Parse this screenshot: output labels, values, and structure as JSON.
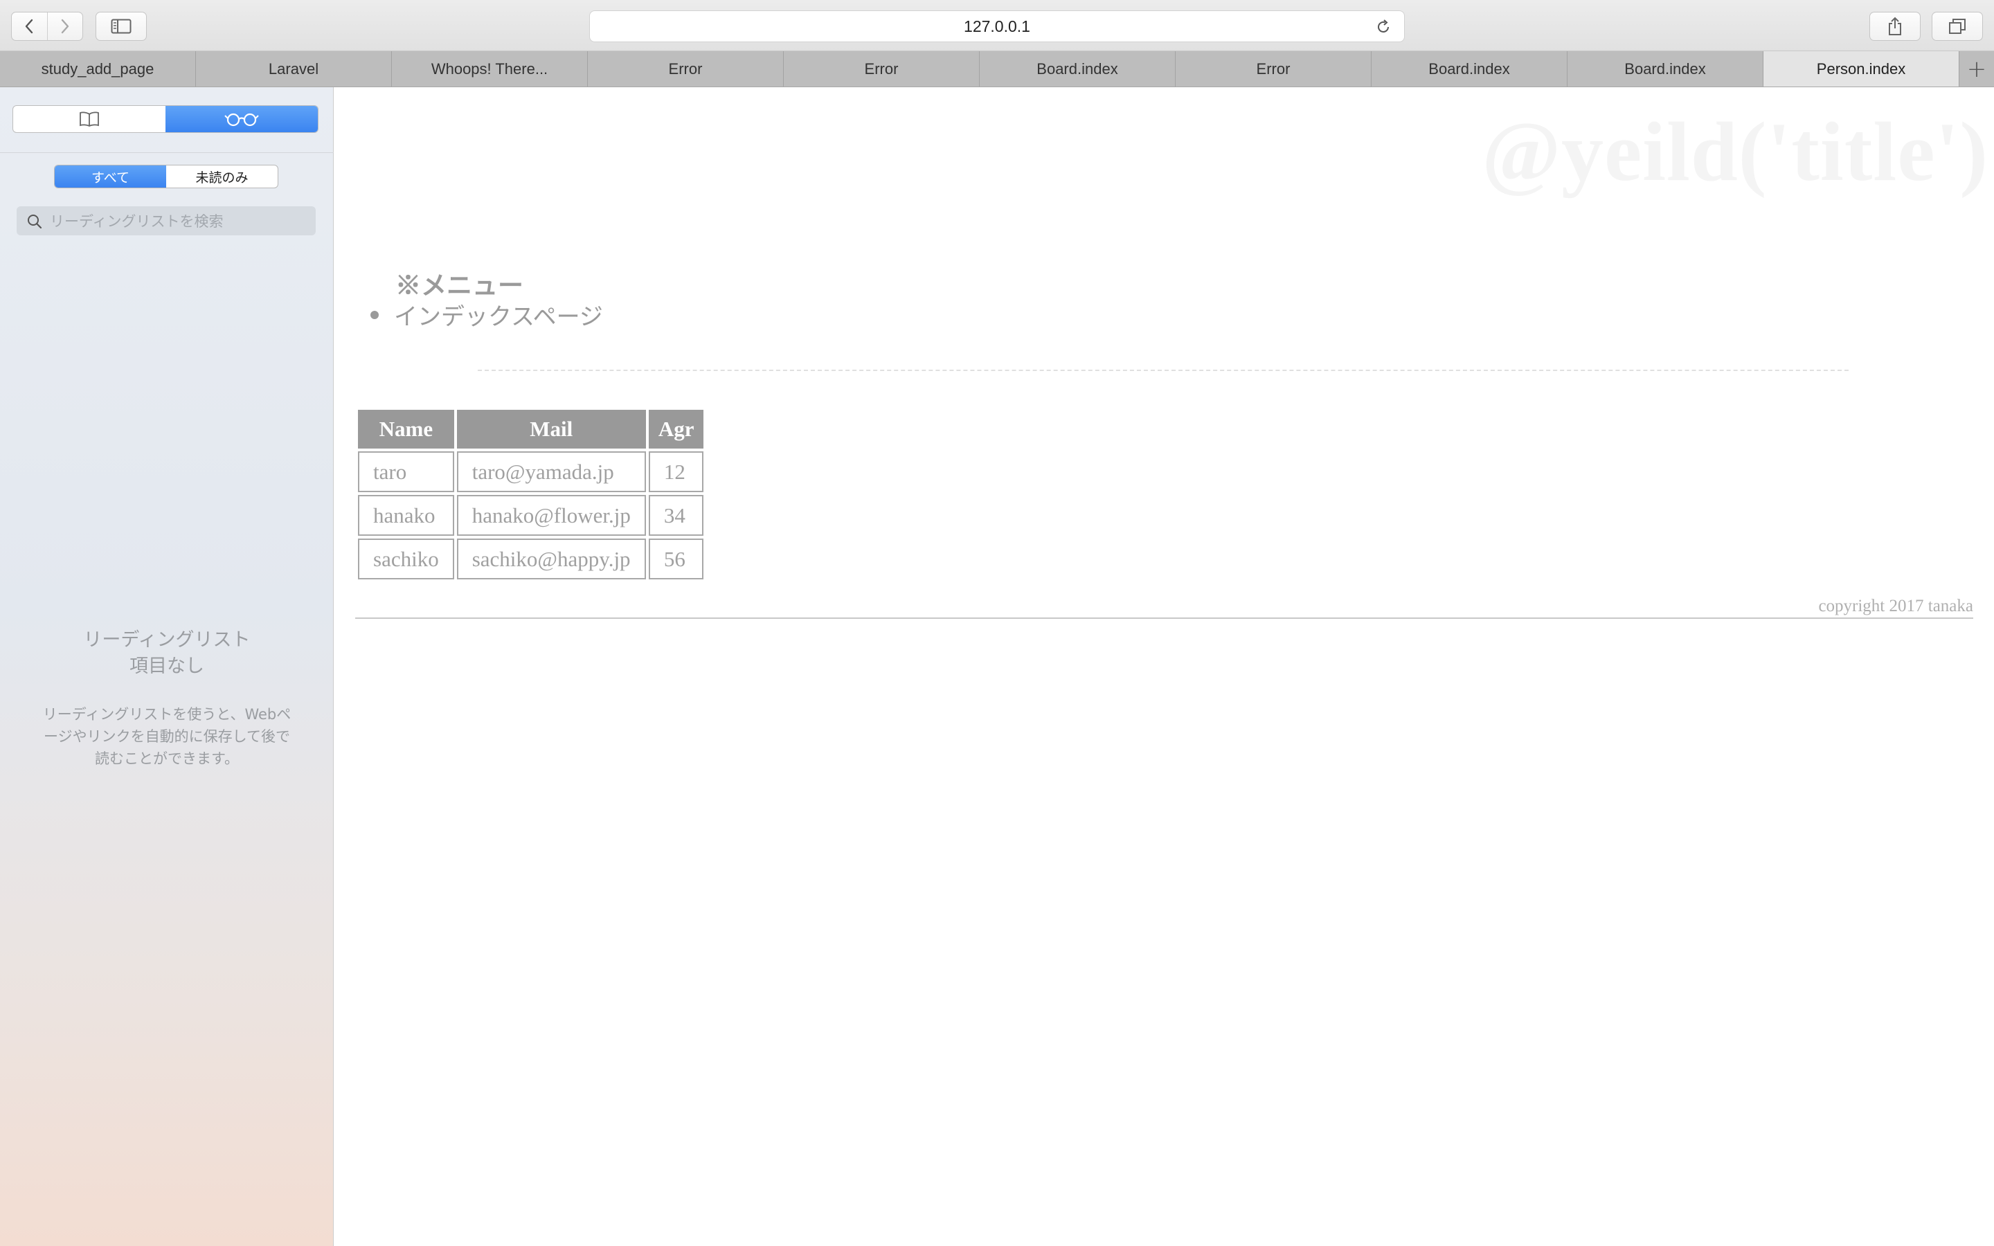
{
  "browser": {
    "address": "127.0.0.1",
    "tabs": [
      {
        "label": "study_add_page",
        "active": false
      },
      {
        "label": "Laravel",
        "active": false
      },
      {
        "label": "Whoops! There...",
        "active": false
      },
      {
        "label": "Error",
        "active": false
      },
      {
        "label": "Error",
        "active": false
      },
      {
        "label": "Board.index",
        "active": false
      },
      {
        "label": "Error",
        "active": false
      },
      {
        "label": "Board.index",
        "active": false
      },
      {
        "label": "Board.index",
        "active": false
      },
      {
        "label": "Person.index",
        "active": true
      }
    ],
    "new_tab_label": "+"
  },
  "sidebar": {
    "top_segments": [
      {
        "icon": "bookmarks-book-icon",
        "active": false
      },
      {
        "icon": "reading-list-glasses-icon",
        "active": true
      }
    ],
    "filter": {
      "all_label": "すべて",
      "unread_label": "未読のみ",
      "active": "all"
    },
    "search_placeholder": "リーディングリストを検索",
    "empty_title_line1": "リーディングリスト",
    "empty_title_line2": "項目なし",
    "empty_desc_line1": "リーディングリストを使うと、Webペ",
    "empty_desc_line2": "ージやリンクを自動的に保存して後で",
    "empty_desc_line3": "読むことができます。"
  },
  "page": {
    "watermark": "@yeild('title')",
    "menu_title": "※メニュー",
    "menu_items": [
      "インデックスページ"
    ],
    "table": {
      "headers": [
        "Name",
        "Mail",
        "Agr"
      ],
      "rows": [
        [
          "taro",
          "taro@yamada.jp",
          "12"
        ],
        [
          "hanako",
          "hanako@flower.jp",
          "34"
        ],
        [
          "sachiko",
          "sachiko@happy.jp",
          "56"
        ]
      ]
    },
    "footer": "copyright 2017 tanaka"
  },
  "colors": {
    "accent": "#3b84f0",
    "table_header_bg": "#999999",
    "text_gray": "#9a9a9a"
  }
}
